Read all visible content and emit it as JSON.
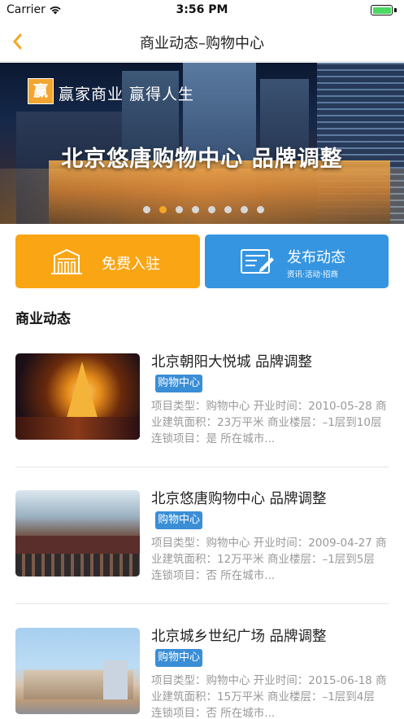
{
  "status_bar": {
    "carrier": "Carrier",
    "time": "3:56 PM"
  },
  "nav": {
    "title": "商业动态–购物中心",
    "back_icon": "chevron-left-icon"
  },
  "banner": {
    "logo_char": "赢",
    "slogan": "赢家商业  赢得人生",
    "headline": "北京悠唐购物中心 品牌调整",
    "dots_total": 8,
    "active_dot": 1
  },
  "actions": {
    "join_label": "免费入驻",
    "publish_label": "发布动态",
    "publish_sub": "资讯·活动·招商"
  },
  "section_title": "商业动态",
  "colors": {
    "accent_orange": "#faa514",
    "accent_blue": "#3695e0",
    "tag_blue": "#3a8ed6"
  },
  "items": [
    {
      "title": "北京朝阳大悦城 品牌调整",
      "tag": "购物中心",
      "desc": "项目类型：购物中心  开业时间：2010-05-28  商业建筑面积：23万平米  商业楼层：–1层到10层  连锁项目：是  所在城市..."
    },
    {
      "title": "北京悠唐购物中心 品牌调整",
      "tag": "购物中心",
      "desc": "项目类型：购物中心  开业时间：2009-04-27  商业建筑面积：12万平米  商业楼层：–1层到5层  连锁项目：否  所在城市..."
    },
    {
      "title": "北京城乡世纪广场 品牌调整",
      "tag": "购物中心",
      "desc": "项目类型：购物中心  开业时间：2015-06-18  商业建筑面积：15万平米  商业楼层：–1层到4层  连锁项目：否  所在城市..."
    }
  ]
}
